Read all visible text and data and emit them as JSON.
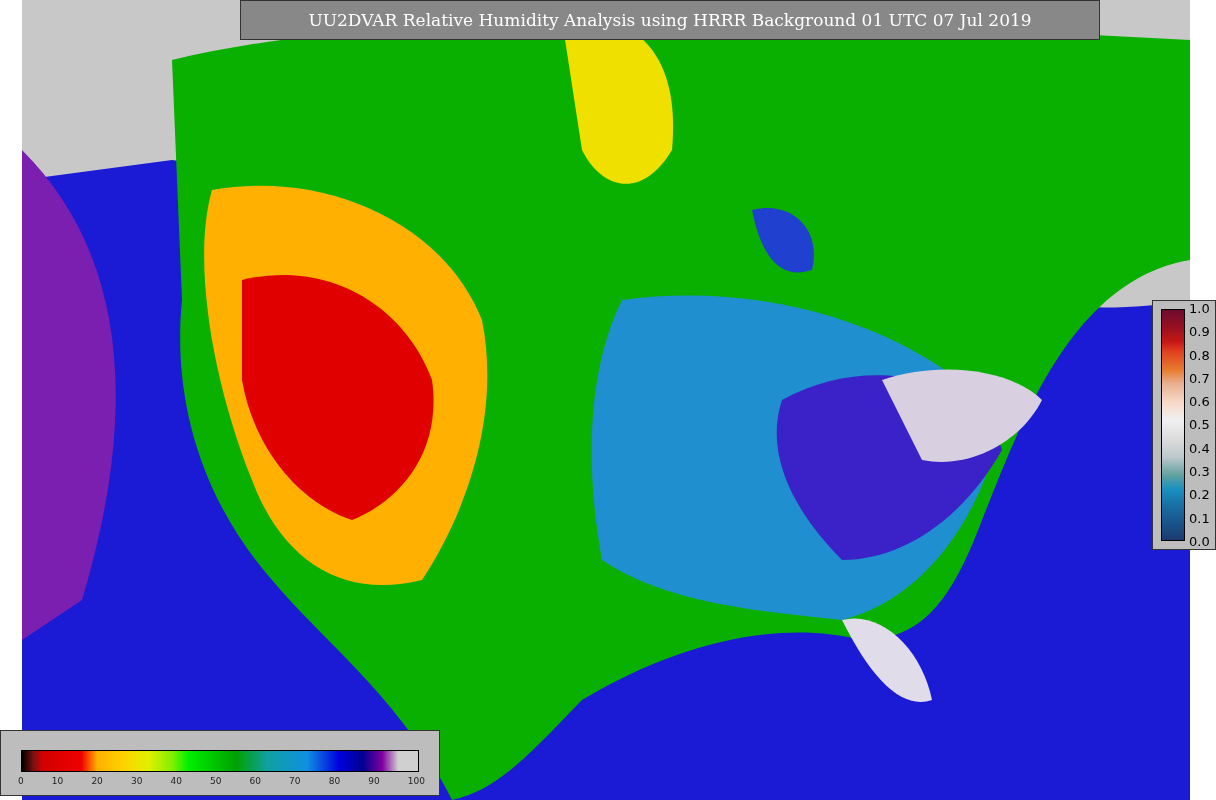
{
  "title": "UU2DVAR Relative Humidity Analysis using HRRR Background 01 UTC 07 Jul 2019",
  "observation_colorbar": {
    "ticks": [
      "1.0",
      "0.9",
      "0.8",
      "0.7",
      "0.6",
      "0.5",
      "0.4",
      "0.3",
      "0.2",
      "0.1",
      "0.0"
    ]
  },
  "humidity_colorbar": {
    "ticks": [
      "0",
      "10",
      "20",
      "30",
      "40",
      "50",
      "60",
      "70",
      "80",
      "90",
      "100"
    ]
  }
}
